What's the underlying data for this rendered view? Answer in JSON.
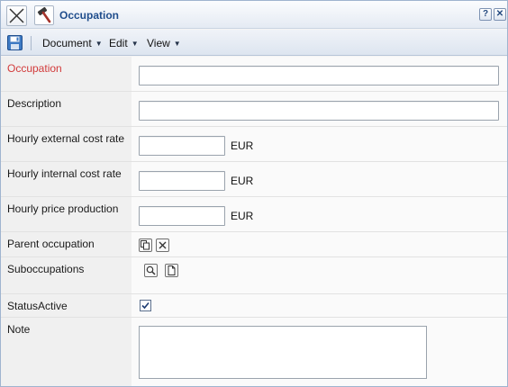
{
  "window": {
    "title": "Occupation",
    "help_label": "?",
    "close_label": "✕"
  },
  "menu": {
    "document": "Document",
    "edit": "Edit",
    "view": "View"
  },
  "form": {
    "occupation": {
      "label": "Occupation",
      "value": ""
    },
    "description": {
      "label": "Description",
      "value": ""
    },
    "hourly_external": {
      "label": "Hourly external cost rate",
      "value": "",
      "unit": "EUR"
    },
    "hourly_internal": {
      "label": "Hourly internal cost rate",
      "value": "",
      "unit": "EUR"
    },
    "hourly_price": {
      "label": "Hourly price production",
      "value": "",
      "unit": "EUR"
    },
    "parent_occupation": {
      "label": "Parent occupation"
    },
    "suboccupations": {
      "label": "Suboccupations"
    },
    "status_active": {
      "label": "StatusActive",
      "checked": true
    },
    "note": {
      "label": "Note",
      "value": ""
    }
  },
  "colors": {
    "required_label": "#d23b3b",
    "title_text": "#1f4d8c"
  }
}
